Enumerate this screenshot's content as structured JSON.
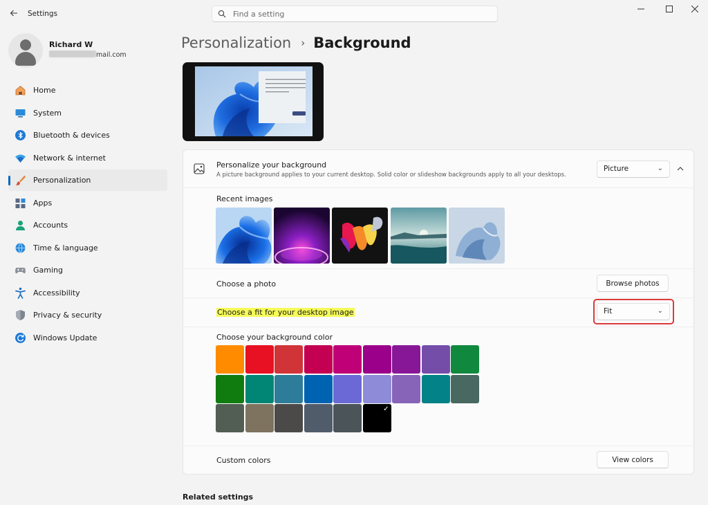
{
  "titlebar": {
    "app_title": "Settings",
    "search_placeholder": "Find a setting"
  },
  "user": {
    "name": "Richard W",
    "email_visible": "mail.com"
  },
  "sidebar": {
    "items": [
      {
        "label": "Home",
        "icon": "home-icon"
      },
      {
        "label": "System",
        "icon": "system-icon"
      },
      {
        "label": "Bluetooth & devices",
        "icon": "bluetooth-icon"
      },
      {
        "label": "Network & internet",
        "icon": "network-icon"
      },
      {
        "label": "Personalization",
        "icon": "personalization-icon",
        "active": true
      },
      {
        "label": "Apps",
        "icon": "apps-icon"
      },
      {
        "label": "Accounts",
        "icon": "accounts-icon"
      },
      {
        "label": "Time & language",
        "icon": "time-language-icon"
      },
      {
        "label": "Gaming",
        "icon": "gaming-icon"
      },
      {
        "label": "Accessibility",
        "icon": "accessibility-icon"
      },
      {
        "label": "Privacy & security",
        "icon": "privacy-shield-icon"
      },
      {
        "label": "Windows Update",
        "icon": "windows-update-icon"
      }
    ]
  },
  "breadcrumb": {
    "parent": "Personalization",
    "separator": "›",
    "current": "Background"
  },
  "background": {
    "personalize_title": "Personalize your background",
    "personalize_desc": "A picture background applies to your current desktop. Solid color or slideshow backgrounds apply to all your desktops.",
    "type_value": "Picture",
    "recent_images_label": "Recent images",
    "recent_images": [
      "bloom-blue",
      "bloom-purple-glow",
      "ribbon-colorful",
      "lake-sunrise",
      "bloom-light-blue"
    ],
    "choose_photo_label": "Choose a photo",
    "browse_label": "Browse photos",
    "fit_label": "Choose a fit for your desktop image",
    "fit_value": "Fit",
    "bg_color_label": "Choose your background color",
    "custom_colors_label": "Custom colors",
    "view_colors_label": "View colors",
    "colors": [
      [
        "#ff8c00",
        "#e81123",
        "#d13438",
        "#c30052",
        "#bf0077",
        "#9a0089",
        "#881798",
        "#744da9",
        "#10893e"
      ],
      [
        "#107c10",
        "#018574",
        "#2d7d9a",
        "#0063b1",
        "#6b69d6",
        "#8e8cd8",
        "#8764b8",
        "#038387",
        "#486860"
      ],
      [
        "#525e54",
        "#7e735f",
        "#4c4a48",
        "#515c6b",
        "#4a5459",
        "#000000"
      ]
    ],
    "selected_color": "#000000"
  },
  "related": {
    "title": "Related settings"
  },
  "accent": "#0067c0"
}
